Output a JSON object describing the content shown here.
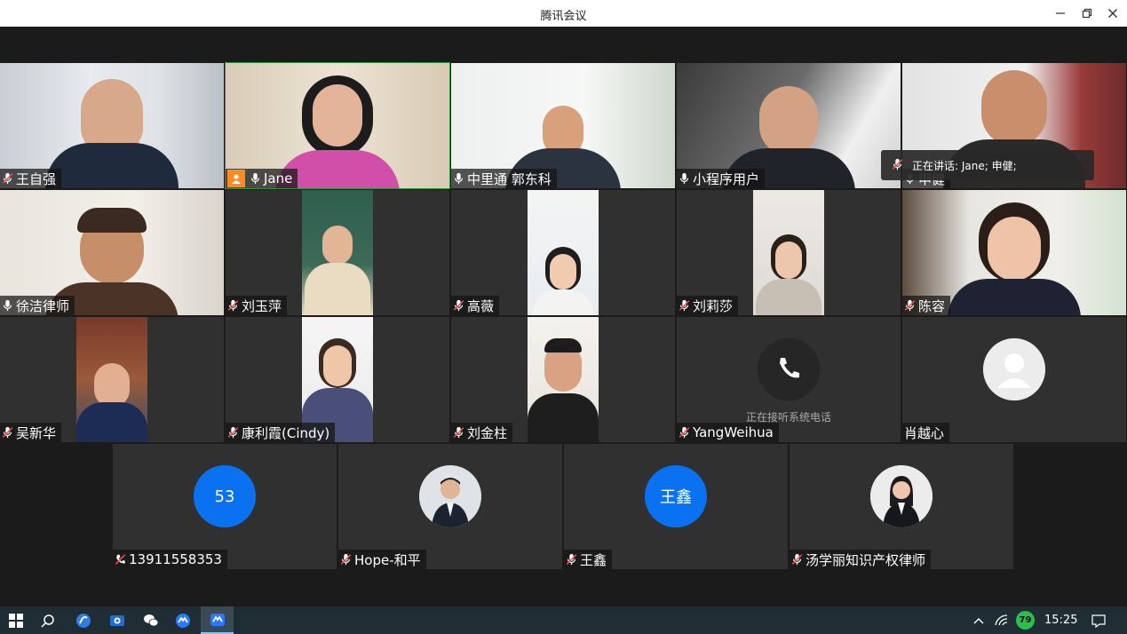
{
  "window": {
    "title": "腾讯会议"
  },
  "speaking": {
    "text": "正在讲话: Jane; 申健;"
  },
  "tiles": [
    {
      "name": "王自强",
      "mic": "muted"
    },
    {
      "name": "Jane",
      "mic": "on",
      "host": true
    },
    {
      "name": "中里通 郭东科",
      "mic": "on"
    },
    {
      "name": "小程序用户",
      "mic": "on"
    },
    {
      "name": "申健",
      "mic": "on"
    },
    {
      "name": "徐洁律师",
      "mic": "on"
    },
    {
      "name": "刘玉萍",
      "mic": "muted"
    },
    {
      "name": "高薇",
      "mic": "muted"
    },
    {
      "name": "刘莉莎",
      "mic": "muted"
    },
    {
      "name": "陈容",
      "mic": "muted"
    },
    {
      "name": "吴新华",
      "mic": "muted"
    },
    {
      "name": "康利霞(Cindy)",
      "mic": "muted"
    },
    {
      "name": "刘金柱",
      "mic": "muted"
    },
    {
      "name": "YangWeihua",
      "mic": "muted",
      "note": "正在接听系统电话"
    },
    {
      "name": "肖越心",
      "mic": "none"
    },
    {
      "name": "13911558353",
      "mic": "phone-muted",
      "avatar_text": "53"
    },
    {
      "name": "Hope-和平",
      "mic": "muted"
    },
    {
      "name": "王鑫",
      "mic": "muted",
      "avatar_text": "王鑫"
    },
    {
      "name": "汤学丽知识产权律师",
      "mic": "muted"
    }
  ],
  "taskbar": {
    "time": "15:25",
    "battery": "79",
    "apps": [
      "windows-start",
      "search",
      "browser",
      "ocr-tool",
      "wechat",
      "tencent-meeting",
      "tencent-meeting-active"
    ]
  },
  "colors": {
    "avatar_blue": "#0a72f0",
    "host_orange": "#ff8a1f",
    "speaking_green": "#2f8f3f",
    "battery_green": "#2dbd4e"
  }
}
